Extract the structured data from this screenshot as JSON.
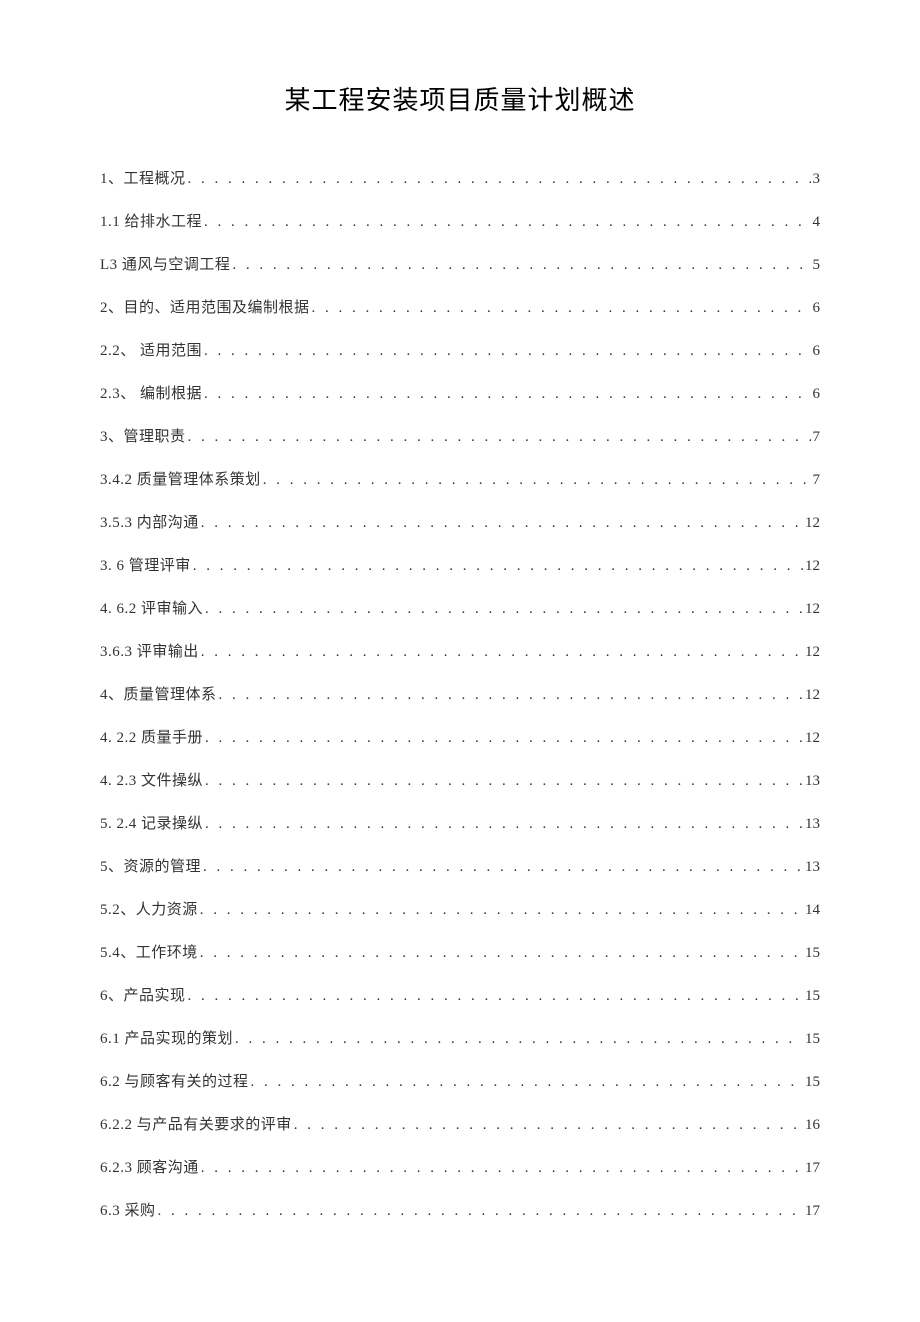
{
  "title": "某工程安装项目质量计划概述",
  "toc": [
    {
      "label": "1、工程概况",
      "page": "3"
    },
    {
      "label": "1.1 给排水工程",
      "page": "4"
    },
    {
      "label": "L3 通风与空调工程",
      "page": "5"
    },
    {
      "label": "2、目的、适用范围及编制根据",
      "page": "6"
    },
    {
      "label": "2.2、 适用范围",
      "page": "6"
    },
    {
      "label": "2.3、 编制根据",
      "page": "6"
    },
    {
      "label": "3、管理职责",
      "page": "7"
    },
    {
      "label": "3.4.2 质量管理体系策划",
      "page": "7"
    },
    {
      "label": "3.5.3 内部沟通",
      "page": "12"
    },
    {
      "label": "3.  6 管理评审",
      "page": "12"
    },
    {
      "label": "4.  6.2 评审输入",
      "page": "12"
    },
    {
      "label": "3.6.3 评审输出",
      "page": "12"
    },
    {
      "label": "4、质量管理体系",
      "page": "12"
    },
    {
      "label": "4.  2.2 质量手册",
      "page": "12"
    },
    {
      "label": "4.  2.3 文件操纵",
      "page": "13"
    },
    {
      "label": "5.  2.4 记录操纵",
      "page": "13"
    },
    {
      "label": "5、资源的管理",
      "page": "13"
    },
    {
      "label": "5.2、人力资源",
      "page": "14"
    },
    {
      "label": "5.4、工作环境",
      "page": "15"
    },
    {
      "label": "6、产品实现",
      "page": "15"
    },
    {
      "label": "6.1 产品实现的策划",
      "page": "15"
    },
    {
      "label": "6.2 与顾客有关的过程",
      "page": "15"
    },
    {
      "label": "6.2.2 与产品有关要求的评审",
      "page": "16"
    },
    {
      "label": "6.2.3 顾客沟通",
      "page": "17"
    },
    {
      "label": "6.3 采购",
      "page": "17"
    }
  ]
}
